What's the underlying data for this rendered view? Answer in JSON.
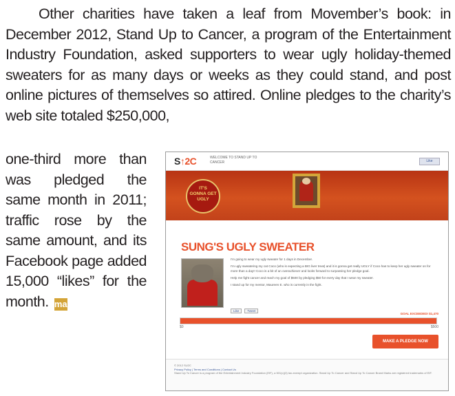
{
  "article": {
    "paragraph1": "Other charities have taken a leaf from Movember’s book: in December 2012, Stand Up to Cancer, a program of the Entertainment Industry Foundation, asked supporters to wear ugly holiday-themed sweaters for as many days or weeks as they could stand, and post online pictures of themselves so attired. Online pledges to the charity’s web site totaled $250,000,",
    "paragraph2": "one-third more than was pledged the same month in 2011; traffic rose by the same amount, and its Facebook page added 15,000 “likes” for the month.",
    "end_mark": "ma"
  },
  "screenshot": {
    "logo_text": "S",
    "logo_up": "↑",
    "logo_num": "2C",
    "welcome": "WELCOME TO STAND UP TO CANCER",
    "like_label": "Like",
    "badge_line1": "IT'S",
    "badge_line2": "GONNA GET",
    "badge_line3": "UGLY",
    "title": "SUNG'S UGLY SWEATER",
    "body1": "I'm going to wear my ugly sweater for 1 days in December.",
    "body2": "I'm ugly sweatering my cat Coco (who is expecting a BIG liver treat) and it is gonna get really UGLY if Coco has to keep her ugly sweater on for more than a day!! Coco is a bit of an overachiever and looks forward to surpassing her pledge goal.",
    "body3": "Help me fight cancer and reach my goal of $500 by pledging $50 for every day that I wear my sweater.",
    "body4": "I stand up for my mentor, Maureen E. who is currently in the fight.",
    "share1": "Like",
    "share2": "Tweet",
    "goal_label": "GOAL EXCEEDED! $1,470",
    "progress_fraction": 1.0,
    "bar_min": "$0",
    "bar_max": "$500",
    "pledge_button": "MAKE A PLEDGE NOW",
    "footer_line1": "© 2012 SU2C",
    "footer_links": "Privacy Policy | Terms and Conditions | Contact Us",
    "footer_line2": "Stand Up To Cancer is a program of the Entertainment Industry Foundation (EIF), a 501(c)(3) tax-exempt organization. Stand Up To Cancer and Stand Up To Cancer Brand Marks are registered trademarks of EIF."
  }
}
